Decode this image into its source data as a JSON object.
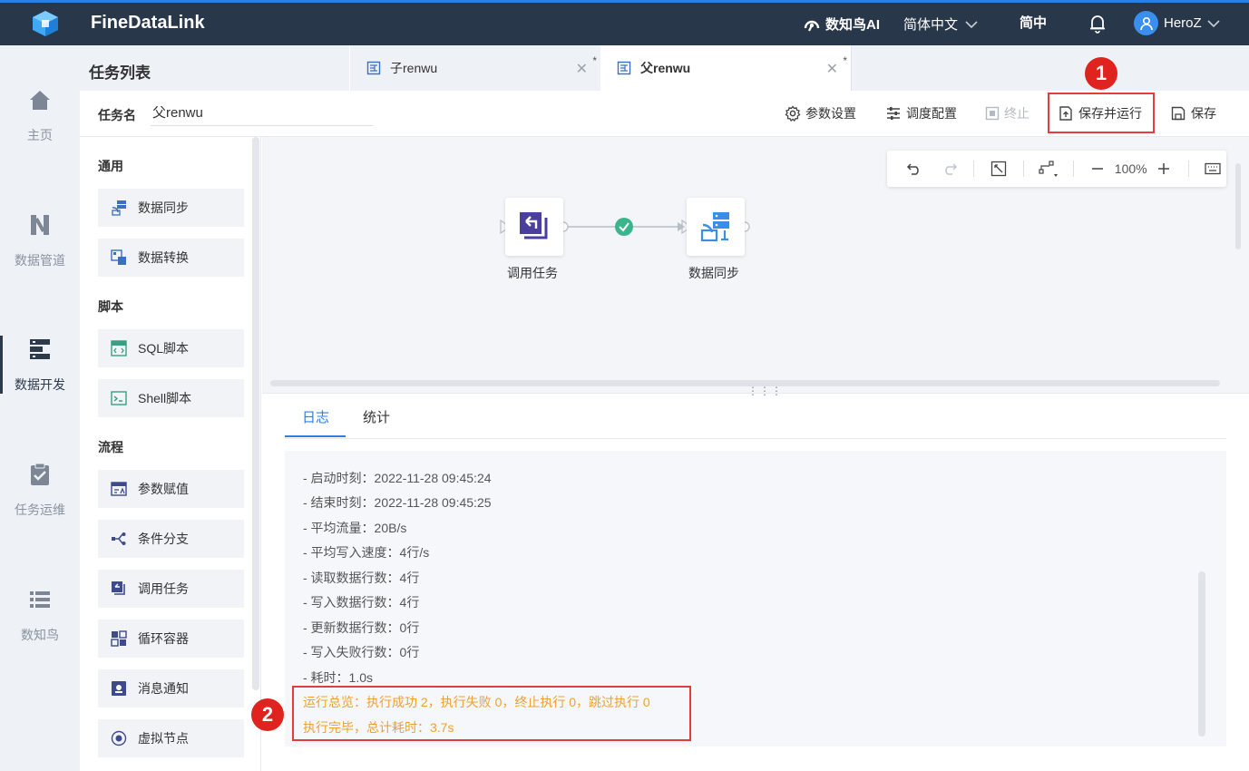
{
  "app": {
    "brand": "FineDataLink",
    "ai_label": "数知鸟AI",
    "language": "简体中文",
    "simplified": "简中",
    "user": "HeroZ"
  },
  "nav": [
    {
      "label": "主页",
      "icon": "home-icon"
    },
    {
      "label": "数据管道",
      "icon": "pipeline-icon"
    },
    {
      "label": "数据开发",
      "icon": "dev-icon"
    },
    {
      "label": "任务运维",
      "icon": "ops-icon"
    },
    {
      "label": "数知鸟",
      "icon": "list-icon"
    }
  ],
  "tasklist_title": "任务列表",
  "tabs": [
    {
      "label": "子renwu",
      "modified": "*"
    },
    {
      "label": "父renwu",
      "modified": "*"
    }
  ],
  "task": {
    "name_label": "任务名",
    "name_value": "父renwu"
  },
  "toolbar": {
    "params": "参数设置",
    "schedule": "调度配置",
    "stop": "终止",
    "save_run": "保存并运行",
    "save": "保存"
  },
  "markers": {
    "one": "1",
    "two": "2"
  },
  "palette": {
    "groups": [
      "通用",
      "脚本",
      "流程"
    ],
    "items": [
      "数据同步",
      "数据转换",
      "SQL脚本",
      "Shell脚本",
      "参数赋值",
      "条件分支",
      "调用任务",
      "循环容器",
      "消息通知",
      "虚拟节点"
    ]
  },
  "canvas": {
    "zoom": "100%",
    "nodes": [
      {
        "label": "调用任务",
        "icon": "call-task-icon"
      },
      {
        "label": "数据同步",
        "icon": "data-sync-icon"
      }
    ]
  },
  "log": {
    "tabs": [
      "日志",
      "统计"
    ],
    "lines": [
      "- 启动时刻：2022-11-28 09:45:24",
      "- 结束时刻：2022-11-28 09:45:25",
      "- 平均流量：20B/s",
      "- 平均写入速度：4行/s",
      "- 读取数据行数：4行",
      "- 写入数据行数：4行",
      "- 更新数据行数：0行",
      "- 写入失败行数：0行",
      "- 耗时：1.0s"
    ],
    "summary": [
      "运行总览：执行成功 2，执行失败 0，终止执行 0，跳过执行 0",
      "执行完毕，总计耗时：3.7s"
    ]
  },
  "colors": {
    "topbar": "#29374a",
    "accent": "#2f7fe0",
    "highlight": "#e23c3c",
    "warn": "#f0a030"
  }
}
